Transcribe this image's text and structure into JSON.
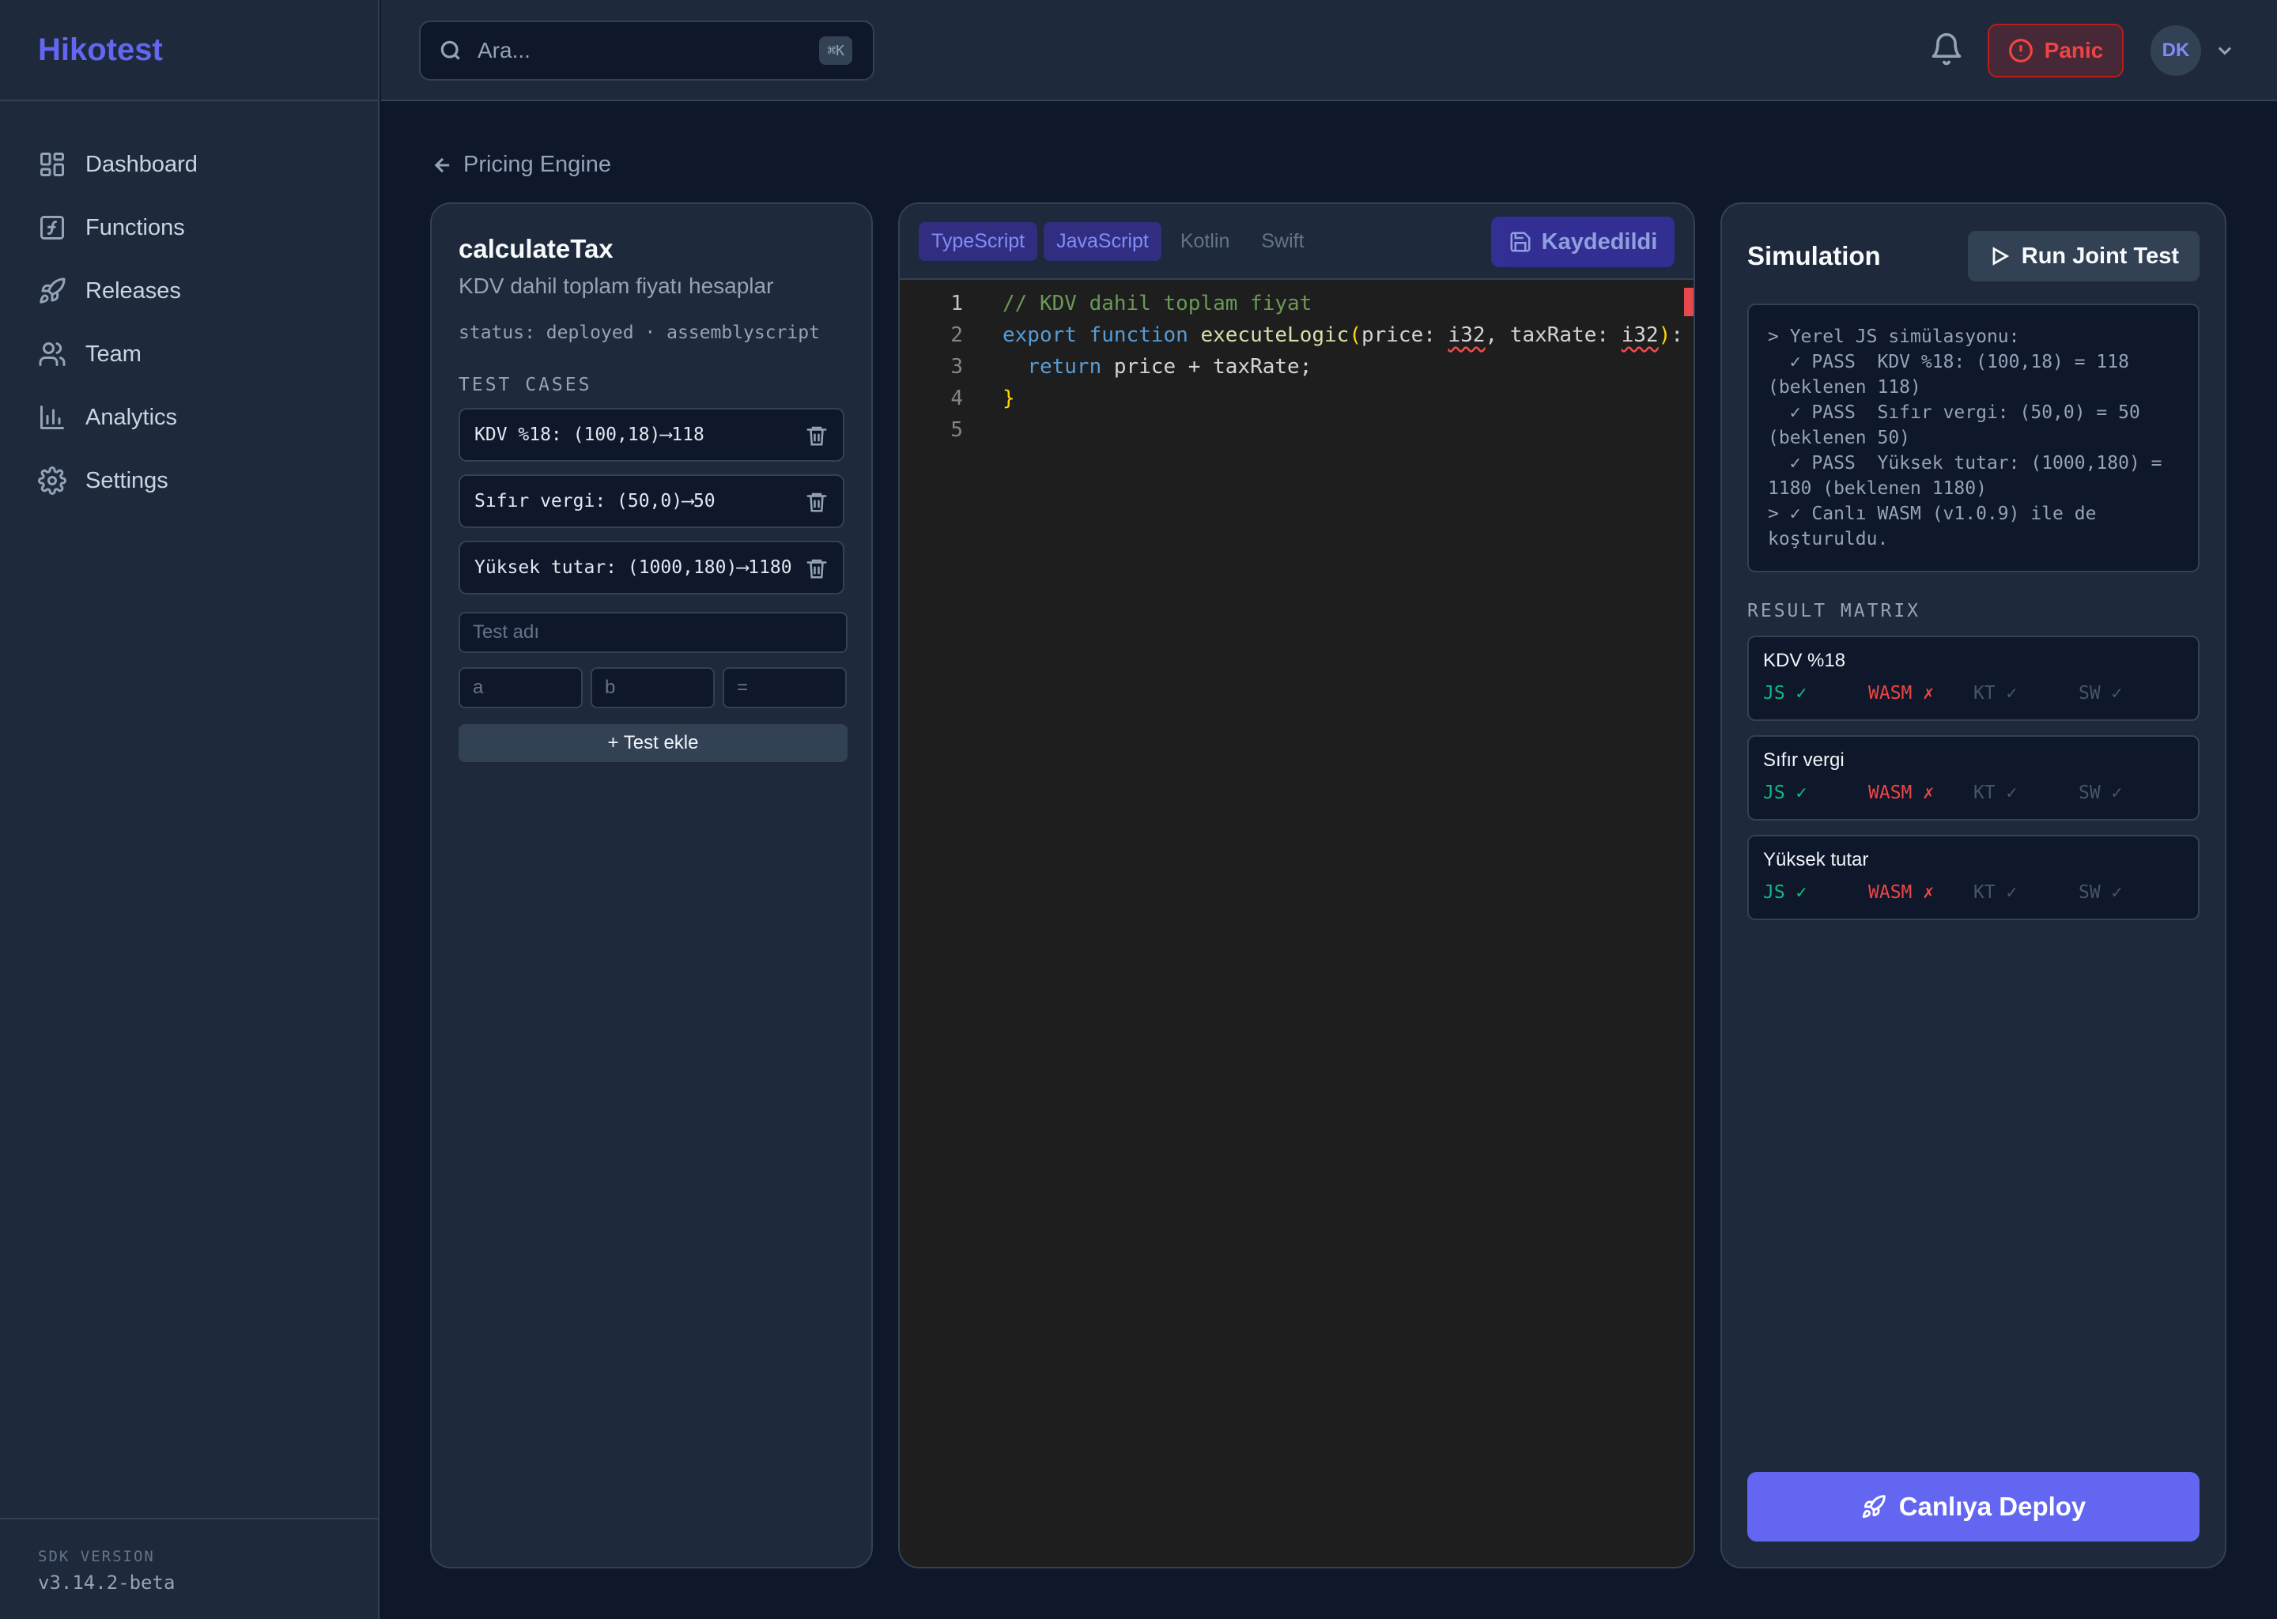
{
  "app": {
    "name": "Hikotest"
  },
  "sidebar": {
    "items": [
      {
        "label": "Dashboard",
        "icon": "dashboard-icon"
      },
      {
        "label": "Functions",
        "icon": "function-icon"
      },
      {
        "label": "Releases",
        "icon": "rocket-icon"
      },
      {
        "label": "Team",
        "icon": "users-icon"
      },
      {
        "label": "Analytics",
        "icon": "bar-chart-icon"
      },
      {
        "label": "Settings",
        "icon": "gear-icon"
      }
    ],
    "sdk_label": "SDK VERSION",
    "sdk_value": "v3.14.2-beta"
  },
  "header": {
    "search_placeholder": "Ara...",
    "search_shortcut": "⌘K",
    "panic_label": "Panic",
    "avatar_initials": "DK"
  },
  "breadcrumb": {
    "label": "Pricing Engine"
  },
  "function": {
    "name": "calculateTax",
    "description": "KDV dahil toplam fiyatı hesaplar",
    "status": "status: deployed · assemblyscript",
    "test_cases_label": "TEST CASES",
    "test_cases": [
      "KDV %18: (100,18)⟶118",
      "Sıfır vergi: (50,0)⟶50",
      "Yüksek tutar: (1000,180)⟶1180"
    ],
    "new_test_placeholder": "Test adı",
    "input_a_placeholder": "a",
    "input_b_placeholder": "b",
    "input_expected_placeholder": "=",
    "add_test_label": "+ Test ekle"
  },
  "editor": {
    "tabs": [
      "TypeScript",
      "JavaScript",
      "Kotlin",
      "Swift"
    ],
    "saved_label": "Kaydedildi",
    "line_numbers": [
      "1",
      "2",
      "3",
      "4",
      "5"
    ]
  },
  "simulation": {
    "title": "Simulation",
    "run_label": "Run Joint Test",
    "console": [
      "> Yerel JS simülasyonu:",
      "  ✓ PASS  KDV %18: (100,18) = 118 (beklenen 118)",
      "  ✓ PASS  Sıfır vergi: (50,0) = 50 (beklenen 50)",
      "  ✓ PASS  Yüksek tutar: (1000,180) = 1180 (beklenen 1180)",
      "> ✓ Canlı WASM (v1.0.9) ile de koşturuldu."
    ],
    "result_matrix_label": "RESULT MATRIX",
    "results": [
      {
        "name": "KDV %18",
        "js": "JS ✓",
        "wasm": "WASM ✗",
        "kt": "KT ✓",
        "sw": "SW ✓"
      },
      {
        "name": "Sıfır vergi",
        "js": "JS ✓",
        "wasm": "WASM ✗",
        "kt": "KT ✓",
        "sw": "SW ✓"
      },
      {
        "name": "Yüksek tutar",
        "js": "JS ✓",
        "wasm": "WASM ✗",
        "kt": "KT ✓",
        "sw": "SW ✓"
      }
    ],
    "deploy_label": "Canlıya Deploy"
  },
  "colors": {
    "accent": "#6366f1",
    "background": "#0f172a",
    "panel": "#1e293b",
    "success": "#10b981",
    "danger": "#ef4444"
  }
}
